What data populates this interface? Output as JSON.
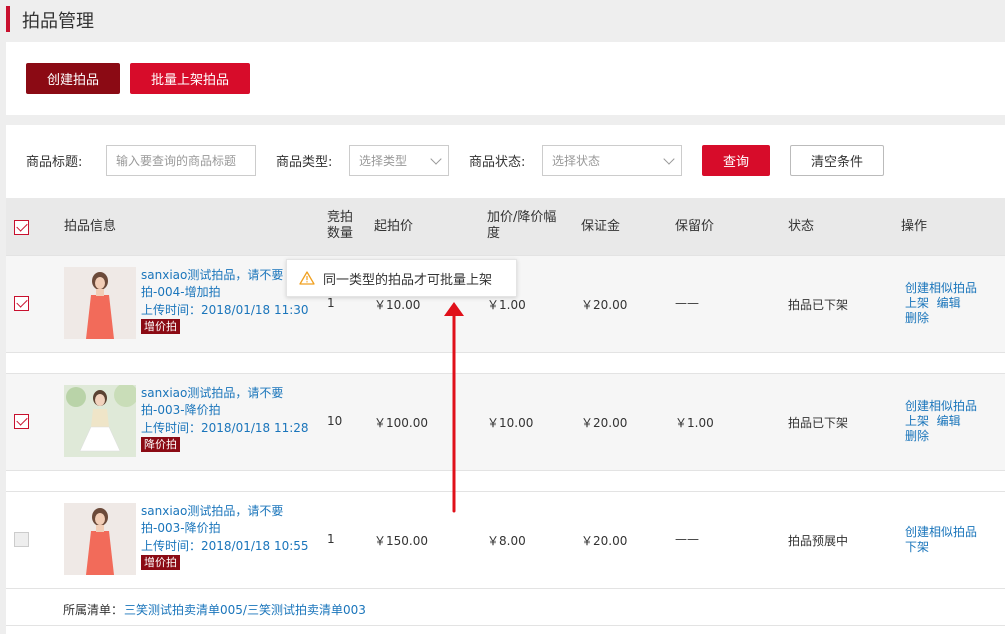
{
  "header": {
    "title": "拍品管理"
  },
  "actions": {
    "create_label": "创建拍品",
    "batch_label": "批量上架拍品"
  },
  "filters": {
    "title_label": "商品标题:",
    "title_placeholder": "输入要查询的商品标题",
    "type_label": "商品类型:",
    "type_placeholder": "选择类型",
    "status_label": "商品状态:",
    "status_placeholder": "选择状态",
    "query_label": "查询",
    "clear_label": "清空条件"
  },
  "table": {
    "columns": {
      "info": "拍品信息",
      "bids": "竞拍数量",
      "start": "起拍价",
      "step": "加价/降价幅度",
      "deposit": "保证金",
      "reserve": "保留价",
      "status": "状态",
      "ops": "操作"
    },
    "rows": [
      {
        "name": "sanxiao测试拍品，请不要拍-004-增加拍",
        "time": "上传时间：2018/01/18 11:30",
        "tag": "增价拍",
        "bids": "1",
        "start": "￥10.00",
        "step": "￥1.00",
        "deposit": "￥20.00",
        "reserve": "——",
        "status": "拍品已下架",
        "op1": "创建相似拍品",
        "op2": "上架",
        "op3": "编辑",
        "op4": "删除"
      },
      {
        "name": "sanxiao测试拍品，请不要拍-003-降价拍",
        "time": "上传时间：2018/01/18 11:28",
        "tag": "降价拍",
        "bids": "10",
        "start": "￥100.00",
        "step": "￥10.00",
        "deposit": "￥20.00",
        "reserve": "￥1.00",
        "status": "拍品已下架",
        "op1": "创建相似拍品",
        "op2": "上架",
        "op3": "编辑",
        "op4": "删除"
      },
      {
        "name": "sanxiao测试拍品，请不要拍-003-降价拍",
        "time": "上传时间：2018/01/18 10:55",
        "tag": "增价拍",
        "bids": "1",
        "start": "￥150.00",
        "step": "￥8.00",
        "deposit": "￥20.00",
        "reserve": "——",
        "status": "拍品预展中",
        "op1": "创建相似拍品",
        "op2": "下架"
      }
    ],
    "footer_label": "所属清单：",
    "footer_link1": "三笑测试拍卖清单005",
    "footer_sep": "/",
    "footer_link2": "三笑测试拍卖清单003"
  },
  "tooltip": {
    "text": "同一类型的拍品才可批量上架"
  },
  "colors": {
    "accent": "#d70c2a",
    "dark_accent": "#8b0a14",
    "link": "#1a75bb",
    "warn": "#f0a020"
  }
}
